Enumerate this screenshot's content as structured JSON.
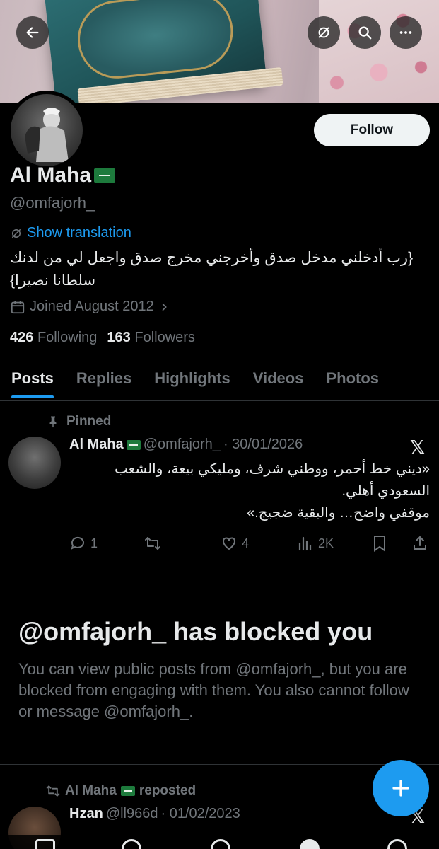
{
  "header": {
    "back_icon": "arrow-left-icon",
    "translate_icon": "translate-off-icon",
    "search_icon": "search-icon",
    "more_icon": "more-icon"
  },
  "profile": {
    "name": "Al Maha",
    "handle": "@omfajorh_",
    "follow_label": "Follow",
    "show_translation": "Show translation",
    "bio": "{رب أدخلني مدخل صدق وأخرجني مخرج صدق واجعل لي من لدنك سلطانا نصيرا}",
    "joined": "Joined August 2012",
    "following_count": "426",
    "following_label": "Following",
    "followers_count": "163",
    "followers_label": "Followers"
  },
  "tabs": [
    {
      "label": "Posts",
      "active": true
    },
    {
      "label": "Replies",
      "active": false
    },
    {
      "label": "Highlights",
      "active": false
    },
    {
      "label": "Videos",
      "active": false
    },
    {
      "label": "Photos",
      "active": false
    }
  ],
  "pinned_post": {
    "pinned_label": "Pinned",
    "name": "Al Maha",
    "handle": "@omfajorh_",
    "date": "· 30/01/2026",
    "text_line1": "«ديني خط أحمر، ووطني شرف، ومليكي بيعة، والشعب السعودي أهلي.",
    "text_line2": "موقفي واضح… والبقية ضجيج.»",
    "replies": "1",
    "likes": "4",
    "views": "2K"
  },
  "blocked": {
    "title": "@omfajorh_ has blocked you",
    "body": "You can view public posts from @omfajorh_, but you are blocked from engaging with them. You also cannot follow or message @omfajorh_."
  },
  "repost": {
    "label": "Al Maha",
    "suffix": "reposted",
    "name": "Hzan",
    "handle": "@ll966d",
    "date": "· 01/02/2023"
  },
  "colors": {
    "accent": "#1d9bf0",
    "background": "#000000",
    "muted": "#71767b",
    "flag": "#1d7a3c"
  }
}
